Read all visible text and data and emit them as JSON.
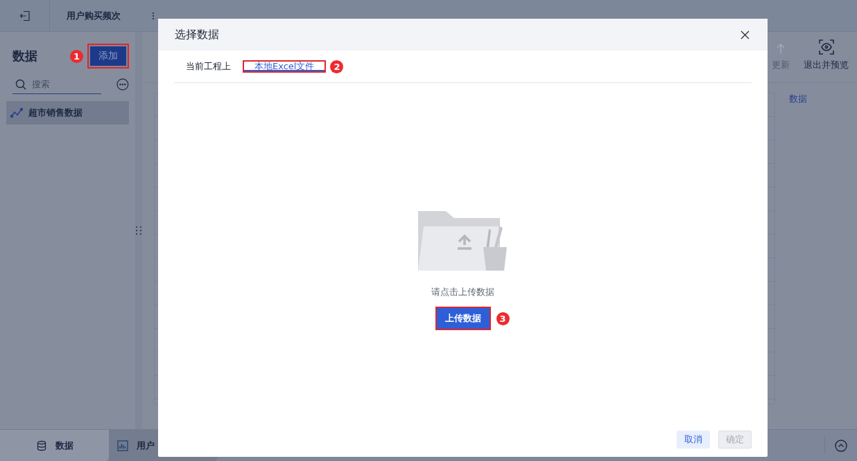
{
  "app_bar": {
    "title": "用户购买频次"
  },
  "sidebar": {
    "title": "数据",
    "add_button": {
      "label": "添加",
      "callout": "1"
    },
    "search": {
      "placeholder": "搜索"
    },
    "items": [
      {
        "label": "超市销售数据",
        "selected": true
      }
    ]
  },
  "toolbar": {
    "actions": [
      {
        "label": "更新",
        "disabled": true
      },
      {
        "label": "退出并预览",
        "disabled": false
      }
    ]
  },
  "content": {
    "link": "数据"
  },
  "bottom_tabs": [
    {
      "label": "数据",
      "kind": "data",
      "selected": true
    },
    {
      "label": "用户",
      "kind": "chart",
      "selected": false
    }
  ],
  "dialog": {
    "title": "选择数据",
    "tabs": [
      {
        "label": "当前工程上",
        "selected": false
      },
      {
        "label": "本地Excel文件",
        "selected": true,
        "callout": "2"
      }
    ],
    "hint": "请点击上传数据",
    "upload_button": {
      "label": "上传数据",
      "callout": "3"
    },
    "buttons": [
      {
        "label": "取消",
        "disabled": false
      },
      {
        "label": "确定",
        "disabled": true
      }
    ]
  }
}
